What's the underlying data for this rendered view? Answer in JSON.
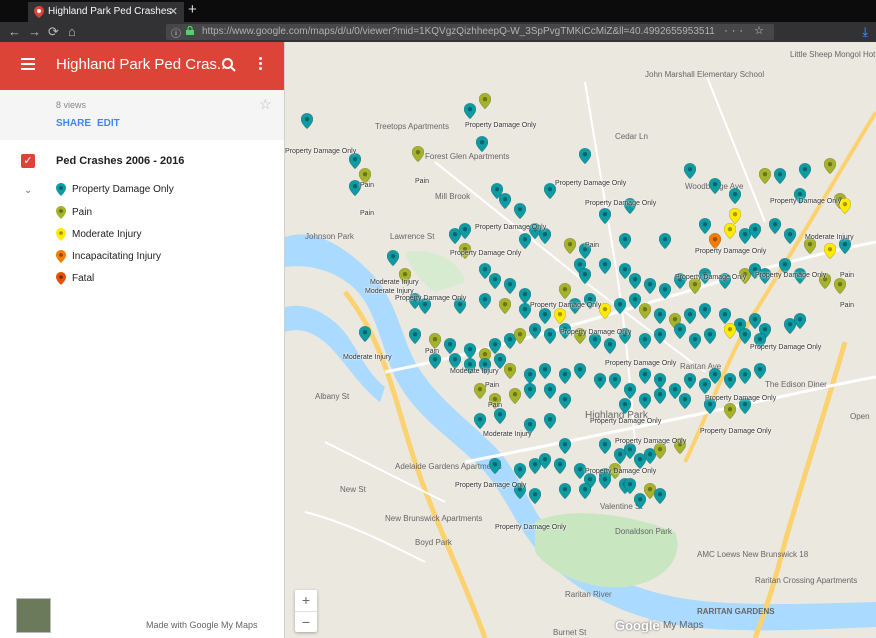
{
  "browser": {
    "tab_title": "Highland Park Ped Crashes",
    "tab_close": "✕",
    "new_tab": "+",
    "url": "https://www.google.com/maps/d/u/0/viewer?mid=1KQVgzQizhheepQ-W_3SpPvgTMKiCcMiZ&ll=40.4992655953511",
    "url_actions": "··· ☆",
    "back": "←",
    "forward": "→",
    "reload": "⟳",
    "home": "⌂",
    "download": "⤓"
  },
  "sidebar": {
    "title": "Highland Park Ped Cras...",
    "views": "8 views",
    "share_label": "SHARE",
    "edit_label": "EDIT",
    "star": "☆",
    "layer_check": "✓",
    "layer_title": "Ped Crashes 2006 - 2016",
    "collapse": "⌄",
    "legend": [
      {
        "label": "Property Damage Only",
        "color": "#0f9ba3"
      },
      {
        "label": "Pain",
        "color": "#a5b22a"
      },
      {
        "label": "Moderate Injury",
        "color": "#ffea00"
      },
      {
        "label": "Incapacitating Injury",
        "color": "#f57c00"
      },
      {
        "label": "Fatal",
        "color": "#e65100"
      }
    ],
    "made_with": "Made with Google My Maps"
  },
  "map": {
    "zoom_in": "+",
    "zoom_out": "−",
    "google_logo": "Google",
    "my_maps": "My Maps",
    "place_labels": [
      "John Marshall Elementary School",
      "Little Sheep Mongol Hot Pot, Edison",
      "Treetops Apartments",
      "Forest Glen Apartments",
      "Mill Brook",
      "Adelaide Gardens Apartments",
      "New Brunswick Apartments",
      "Boyd Park",
      "Donaldson Park",
      "AMC Loews New Brunswick 18",
      "Raritan Crossing Apartments",
      "The Edison Diner",
      "Raritan River",
      "RARITAN GARDENS",
      "Highland Park",
      "Albany St",
      "New St",
      "Valentine St",
      "Cedar Ln",
      "Raritan Ave",
      "Woodbridge Ave",
      "Johnson Park",
      "Lawrence St",
      "Burnet St",
      "Open"
    ],
    "pin_labels": [
      "Property Damage Only",
      "Pain",
      "Property Damage Only",
      "Pain",
      "Pain",
      "Property Damage Only",
      "Property Damage Only",
      "Moderate Injury",
      "Property Damage Only",
      "Moderate Injury",
      "Property Damage Only",
      "Moderate Injury",
      "Property Damage Only",
      "Pain",
      "Pain",
      "Property Damage Only",
      "Pain",
      "Property Damage Only",
      "Moderate Injury",
      "Property Damage Only",
      "Property Damage Only",
      "Pain",
      "Property Damage Only",
      "Property Damage Only",
      "Property Damage Only",
      "Property Damage Only",
      "Moderate Injury",
      "Property Damage Only",
      "Property Damage Only",
      "Pain",
      "Property Damage Only",
      "Property Damage Only",
      "Property Damage Only",
      "Moderate Injury",
      "Property Damage Only",
      "Property Damage Only",
      "Pain"
    ]
  }
}
